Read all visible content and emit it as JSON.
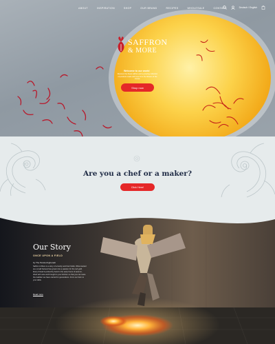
{
  "nav": {
    "items": [
      "About",
      "Inspiration",
      "Shop",
      "Our Brand",
      "Recipes",
      "Wholesale",
      "Contact"
    ],
    "language": "Deutsch / English"
  },
  "hero": {
    "logo_line1": "SAFFRON",
    "logo_line2": "& MORE",
    "tagline": "Welcome to our world",
    "description": "Discover the finest saffron and a growing collection of products made with love from the flowers of the crocus.",
    "button": "Shop now"
  },
  "chef": {
    "heading": "Are you a chef or a maker?",
    "button": "Click Here!"
  },
  "story": {
    "heading": "Our Story",
    "kicker": "ONCE UPON A FIELD",
    "byline": "by The Persia Zoghoradi",
    "body": "Saffron & More is a story of a family and their fields. What started as a small harvest has grown into a passion for the red gold. Every thread is picked by hand in the early hours of autumn, dried with care and brought to your kitchen so that you can taste the tradition we have carried for generations. From our farm to your table.",
    "read_more": "Read more"
  },
  "colors": {
    "accent": "#e52728",
    "heading": "#1e2a44",
    "section_bg": "#e6ebec"
  }
}
